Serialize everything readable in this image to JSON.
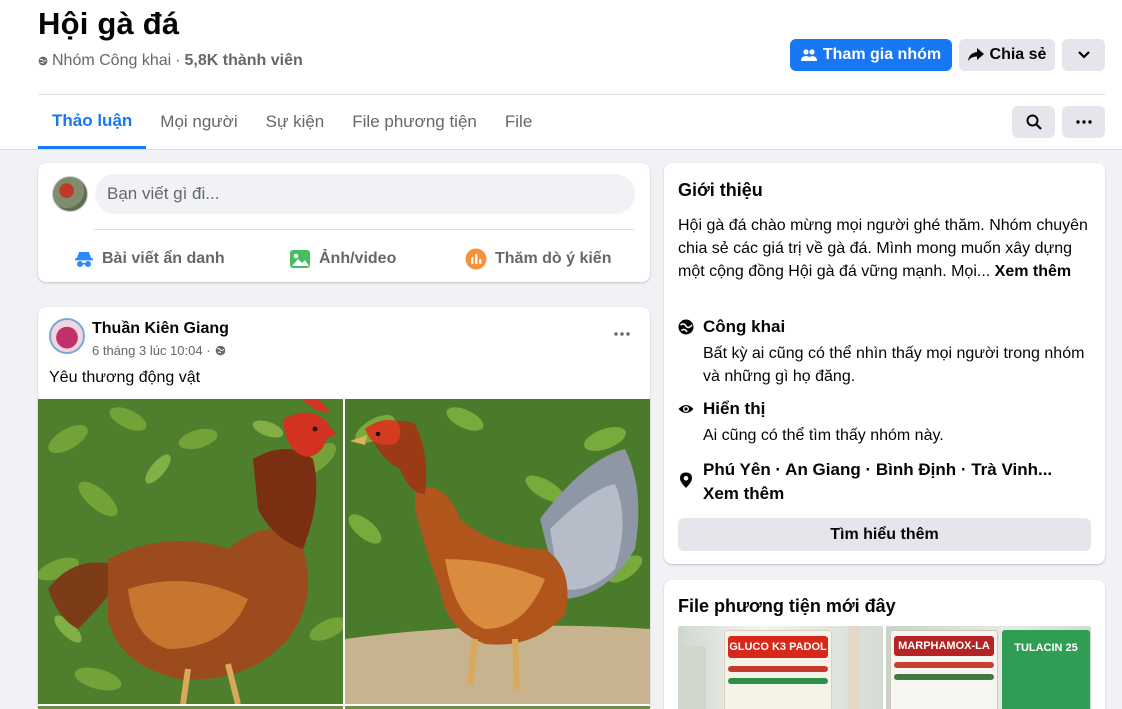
{
  "group": {
    "name": "Hội gà đá",
    "privacy": "Nhóm Công khai",
    "separator": "·",
    "members": "5,8K thành viên"
  },
  "actions": {
    "join": "Tham gia nhóm",
    "share": "Chia sẻ"
  },
  "tabs": [
    {
      "label": "Thảo luận",
      "active": true
    },
    {
      "label": "Mọi người"
    },
    {
      "label": "Sự kiện"
    },
    {
      "label": "File phương tiện"
    },
    {
      "label": "File"
    }
  ],
  "composer": {
    "placeholder": "Bạn viết gì đi...",
    "anon": "Bài viết ẩn danh",
    "photo": "Ảnh/video",
    "poll": "Thăm dò ý kiến"
  },
  "post": {
    "author": "Thuần Kiên Giang",
    "time": "6 tháng 3 lúc 10:04 ·",
    "text": "Yêu thương động vật"
  },
  "intro": {
    "title": "Giới thiệu",
    "description": "Hội gà đá chào mừng mọi người ghé thăm. Nhóm chuyên chia sẻ các giá trị về gà đá. Mình mong muốn xây dựng một cộng đồng Hội gà đá vững mạnh. Mọi...",
    "see_more": "Xem thêm",
    "public_title": "Công khai",
    "public_desc": "Bất kỳ ai cũng có thể nhìn thấy mọi người trong nhóm và những gì họ đăng.",
    "visible_title": "Hiển thị",
    "visible_desc": "Ai cũng có thể tìm thấy nhóm này.",
    "location": "Phú Yên · An Giang · Bình Định · Trà Vinh...",
    "location_more": "Xem thêm",
    "learn_more": "Tìm hiểu thêm"
  },
  "media": {
    "title": "File phương tiện mới đây",
    "products": [
      "GLUCO K3 PADOL",
      "MARPHAMOX-LA",
      "TULACIN 25"
    ]
  },
  "colors": {
    "brand": "#1877f2",
    "background": "#f0f2f5",
    "secondary_text": "#65676b"
  }
}
